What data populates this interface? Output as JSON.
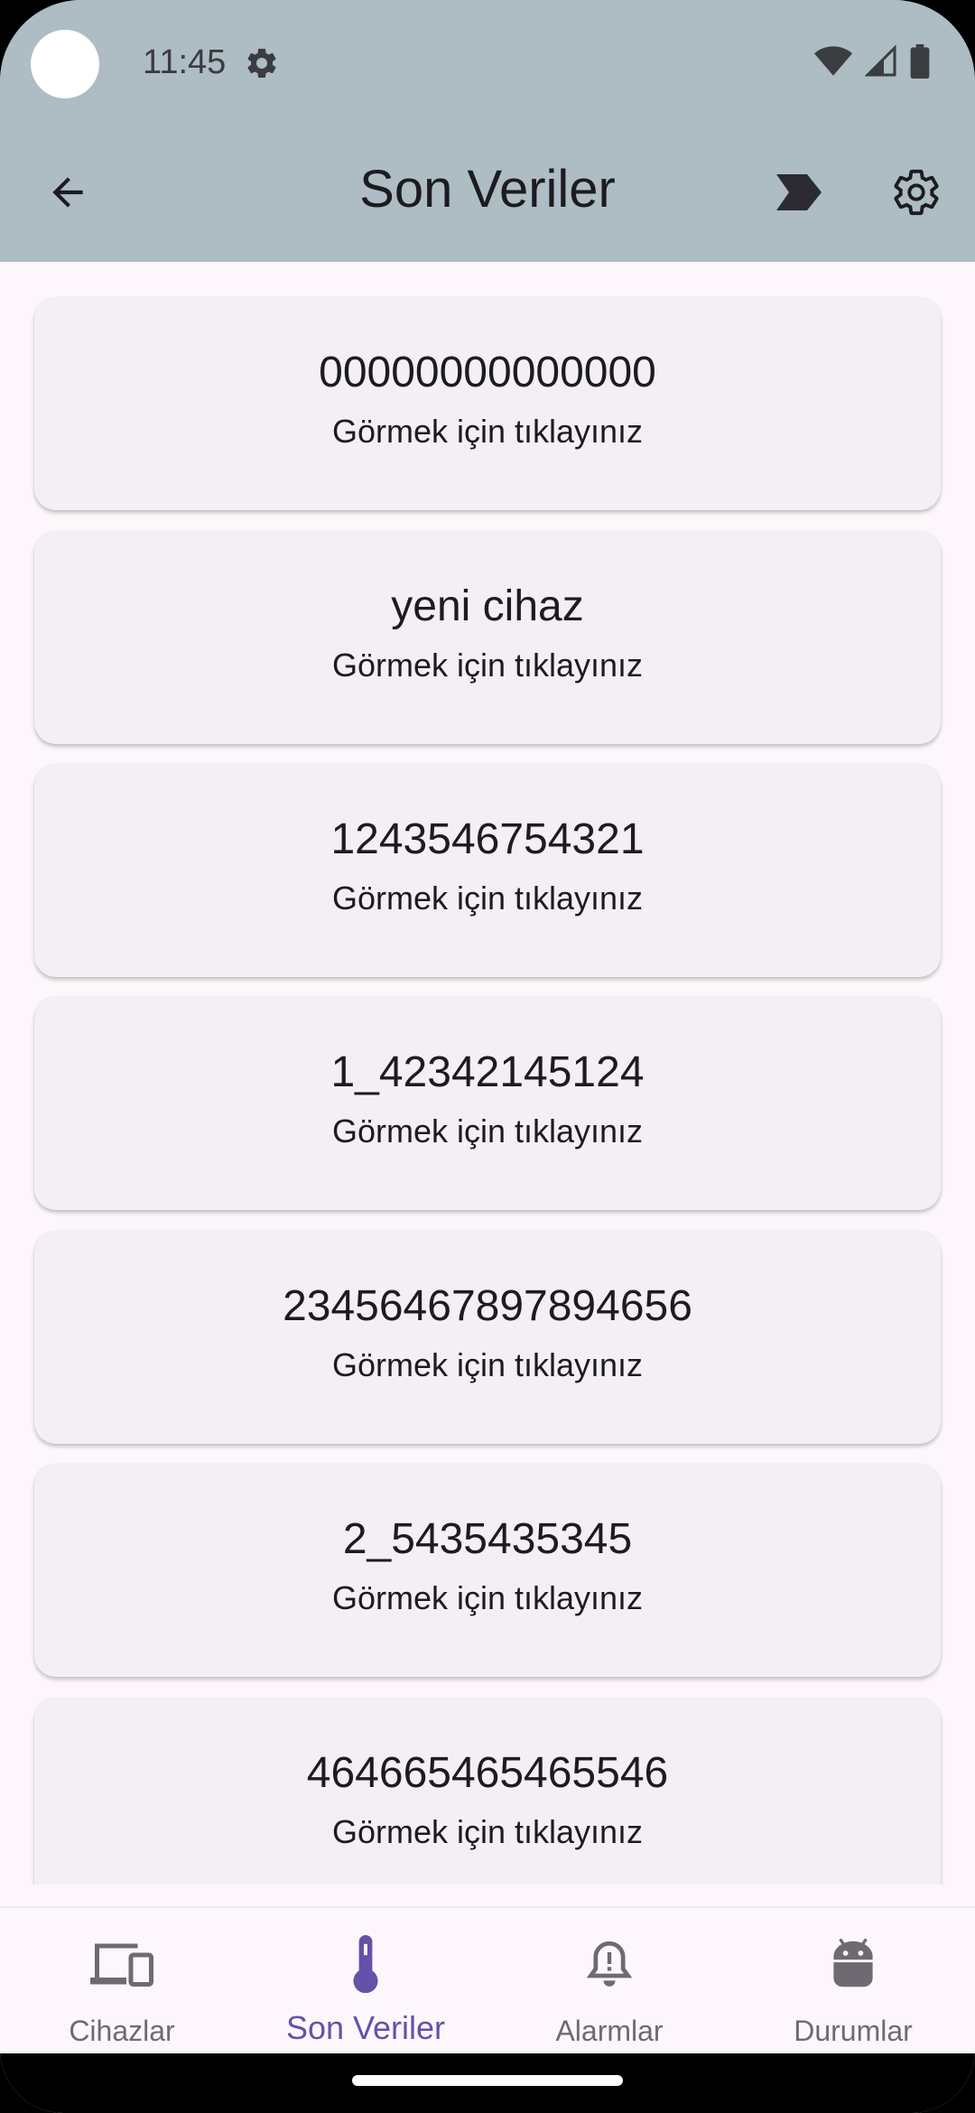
{
  "status_bar": {
    "time": "11:45",
    "icons": [
      "settings-icon",
      "wifi-icon",
      "signal-icon",
      "battery-icon"
    ]
  },
  "appbar": {
    "title": "Son Veriler",
    "icons": [
      "back-arrow-icon",
      "label-icon",
      "gear-icon"
    ]
  },
  "devices": [
    {
      "name": "00000000000000",
      "hint": "Görmek için tıklayınız"
    },
    {
      "name": "yeni cihaz",
      "hint": "Görmek için tıklayınız"
    },
    {
      "name": "1243546754321",
      "hint": "Görmek için tıklayınız"
    },
    {
      "name": "1_42342145124",
      "hint": "Görmek için tıklayınız"
    },
    {
      "name": "23456467897894656",
      "hint": "Görmek için tıklayınız"
    },
    {
      "name": "2_5435435345",
      "hint": "Görmek için tıklayınız"
    },
    {
      "name": "464665465465546",
      "hint": "Görmek için tıklayınız"
    }
  ],
  "bottom_nav": {
    "items": [
      {
        "label": "Cihazlar",
        "icon": "devices-icon",
        "active": false
      },
      {
        "label": "Son Veriler",
        "icon": "thermometer-icon",
        "active": true
      },
      {
        "label": "Alarmlar",
        "icon": "alarm-bell-icon",
        "active": false
      },
      {
        "label": "Durumlar",
        "icon": "android-icon",
        "active": false
      }
    ]
  },
  "colors": {
    "appbar": "#aebcc4",
    "background": "#fdf7fb",
    "card": "#f3eff5",
    "active_nav": "#6651a8",
    "inactive_nav": "#6d6a72"
  }
}
